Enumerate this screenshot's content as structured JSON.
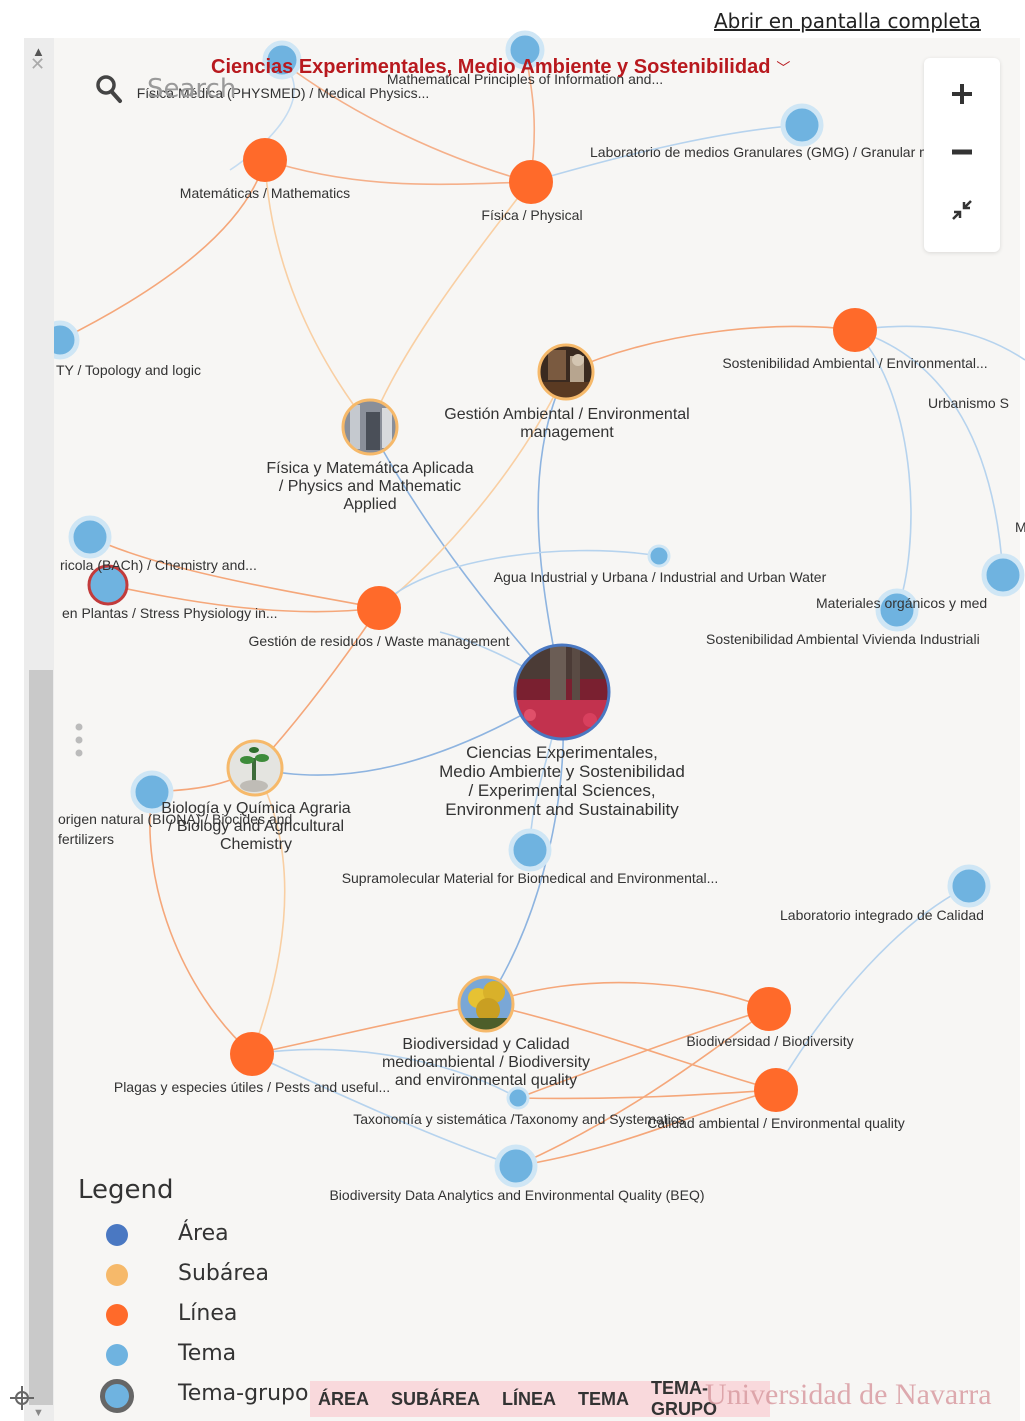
{
  "fullscreen_link": "Abrir en pantalla completa",
  "search": {
    "placeholder": "Search"
  },
  "graph_title": "Ciencias Experimentales, Medio Ambiente y Sostenibilidad",
  "colors": {
    "area": "#4a78c2",
    "subarea": "#f6b96a",
    "linea": "#ff6a2a",
    "tema": "#6fb3e0",
    "tema_grupo": "#6fb3e0",
    "edge_orange": "#f5a77a",
    "edge_blue": "#9dc4ea",
    "title": "#b8191e"
  },
  "zoom_controls": {
    "zoom_in": "plus-icon",
    "zoom_out": "minus-icon",
    "fit": "collapse-icon"
  },
  "graph": {
    "nodes": [
      {
        "id": "area",
        "type": "area",
        "label": [
          "Ciencias Experimentales,",
          "Medio Ambiente y Sostenibilidad",
          "/ Experimental Sciences,",
          "Environment and Sustainability"
        ]
      },
      {
        "id": "gestion_amb",
        "type": "subarea",
        "label": [
          "Gestión Ambiental / Environmental",
          "management"
        ]
      },
      {
        "id": "fisica_mat",
        "type": "subarea",
        "label": [
          "Física y Matemática Aplicada",
          "/ Physics and Mathematic",
          "Applied"
        ]
      },
      {
        "id": "biologia_quim",
        "type": "subarea",
        "label": [
          "Biología y Química Agraria",
          "/ Biology and Agricultural",
          "Chemistry"
        ]
      },
      {
        "id": "biodiv_cal",
        "type": "subarea",
        "label": [
          "Biodiversidad y Calidad",
          "medioambiental / Biodiversity",
          "and environmental quality"
        ]
      },
      {
        "id": "matematicas",
        "type": "linea",
        "label": [
          "Matemáticas / Mathematics"
        ]
      },
      {
        "id": "fisica",
        "type": "linea",
        "label": [
          "Física / Physical"
        ]
      },
      {
        "id": "sostenibilidad",
        "type": "linea",
        "label": [
          "Sostenibilidad Ambiental / Environmental..."
        ]
      },
      {
        "id": "gestion_res",
        "type": "linea",
        "label": [
          "Gestión de residuos  /  Waste management"
        ]
      },
      {
        "id": "plagas",
        "type": "linea",
        "label": [
          "Plagas y especies útiles / Pests and useful..."
        ]
      },
      {
        "id": "biodiversidad",
        "type": "linea",
        "label": [
          "Biodiversidad / Biodiversity"
        ]
      },
      {
        "id": "calidad",
        "type": "linea",
        "label": [
          "Calidad ambiental / Environmental quality"
        ]
      },
      {
        "id": "t_mathprin",
        "type": "tema",
        "label": [
          "Mathematical Principles of Information and..."
        ]
      },
      {
        "id": "t_physmed",
        "type": "tema",
        "label": [
          "Física Médica (PHYSMED) / Medical Physics..."
        ]
      },
      {
        "id": "t_gmg",
        "type": "tema",
        "label": [
          "Laboratorio de medios Granulares (GMG) / Granular media..."
        ]
      },
      {
        "id": "t_topology",
        "type": "tema",
        "label": [
          "TY / Topology and logic"
        ]
      },
      {
        "id": "t_urbanismo",
        "type": "tema",
        "label": [
          "Urbanismo S"
        ]
      },
      {
        "id": "t_bach",
        "type": "tema",
        "label": [
          "ricola (BACh) / Chemistry and..."
        ]
      },
      {
        "id": "t_stress",
        "type": "tema-grupo",
        "label": [
          "en Plantas / Stress Physiology in..."
        ]
      },
      {
        "id": "t_agua",
        "type": "tema",
        "label": [
          "Agua Industrial y Urbana / Industrial and Urban Water"
        ]
      },
      {
        "id": "t_materiales",
        "type": "tema",
        "label": [
          "Materiales orgánicos y med"
        ]
      },
      {
        "id": "t_vivienda",
        "type": "tema",
        "label": [
          "Sostenibilidad Ambiental Vivienda Industriali"
        ]
      },
      {
        "id": "t_origen",
        "type": "tema",
        "label": [
          "origen natural (BIONA) / Biocides and",
          "fertilizers"
        ]
      },
      {
        "id": "t_supra",
        "type": "tema",
        "label": [
          "Supramolecular Material for Biomedical and Environmental..."
        ]
      },
      {
        "id": "t_labcal",
        "type": "tema",
        "label": [
          "Laboratorio integrado de Calidad"
        ]
      },
      {
        "id": "t_taxonomia",
        "type": "tema",
        "label": [
          "Taxonomía y sistemática /Taxonomy and Systematics"
        ]
      },
      {
        "id": "t_beq",
        "type": "tema",
        "label": [
          "Biodiversity Data Analytics and Environmental Quality (BEQ)"
        ]
      },
      {
        "id": "t_edge_m",
        "type": "tema",
        "label": [
          "M"
        ]
      }
    ]
  },
  "legend": {
    "title": "Legend",
    "items": [
      {
        "label": "Área",
        "color": "#4a78c2"
      },
      {
        "label": "Subárea",
        "color": "#f6b96a"
      },
      {
        "label": "Línea",
        "color": "#ff6a2a"
      },
      {
        "label": "Tema",
        "color": "#6fb3e0"
      },
      {
        "label": "Tema-grupo",
        "color": "#6fb3e0"
      }
    ]
  },
  "filter_bar": [
    "ÁREA",
    "SUBÁREA",
    "LÍNEA",
    "TEMA",
    "TEMA-GRUPO"
  ],
  "watermark": "Universidad de Navarra"
}
